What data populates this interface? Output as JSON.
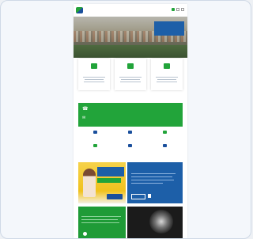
{
  "site": {
    "logo_text": "",
    "nav": [
      "",
      "",
      "",
      "",
      "",
      ""
    ]
  },
  "hero": {
    "box_title": "",
    "box_subtitle": ""
  },
  "services": [
    {
      "title": "",
      "icon": "badge-icon"
    },
    {
      "title": "",
      "icon": "map-icon"
    },
    {
      "title": "",
      "icon": "chart-icon"
    }
  ],
  "contact": {
    "phone_label": "",
    "phone_number": "",
    "email_label": "",
    "email_value": ""
  },
  "links": [
    {
      "label": "",
      "icon": "document-icon"
    },
    {
      "label": "",
      "icon": "pencil-icon"
    },
    {
      "label": "",
      "icon": "leaf-icon"
    },
    {
      "label": "",
      "icon": "list-icon"
    },
    {
      "label": "",
      "icon": "card-icon"
    },
    {
      "label": "",
      "icon": "doc-icon"
    }
  ],
  "promo": {
    "banner_text": ""
  },
  "about": {
    "title": ""
  },
  "news": {
    "title": "",
    "image_caption": ""
  },
  "colors": {
    "brand_green": "#22a43a",
    "brand_blue": "#1d5fa8",
    "accent_yellow": "#f0c21e"
  }
}
